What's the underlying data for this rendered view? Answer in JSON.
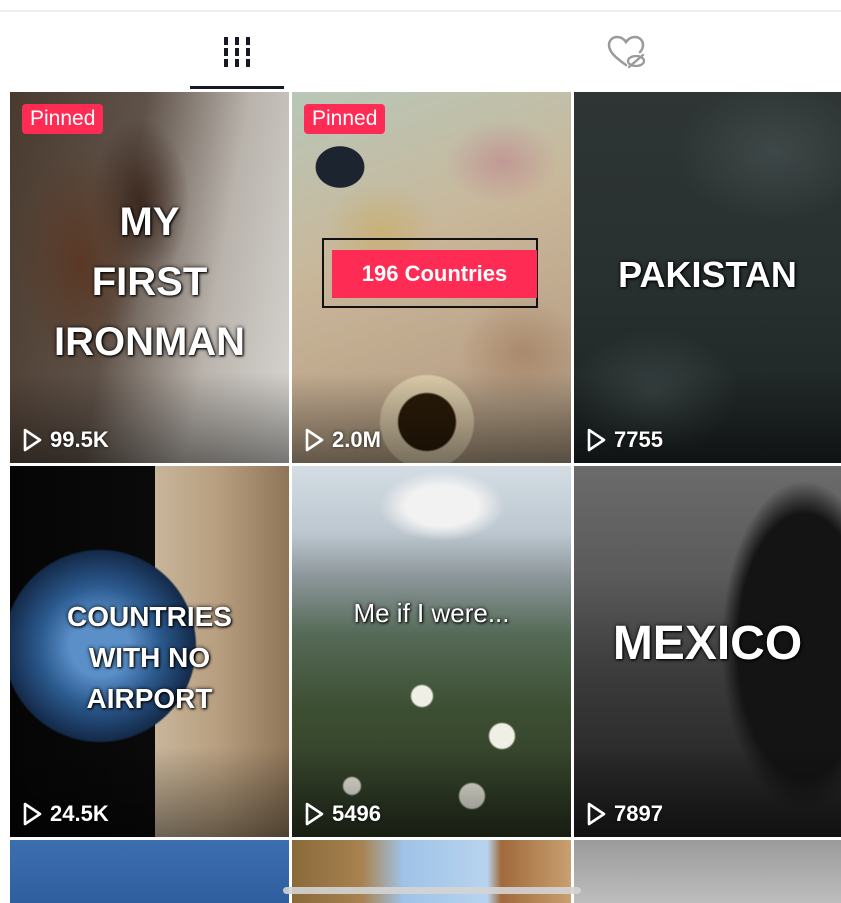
{
  "tabs": [
    {
      "name": "videos",
      "icon": "grid-bars-icon",
      "active": true
    },
    {
      "name": "liked",
      "icon": "liked-hidden-icon",
      "active": false
    }
  ],
  "colors": {
    "accent": "#fe2c55",
    "indicator": "#161823"
  },
  "videos": [
    {
      "pinned_label": "Pinned",
      "caption": "MY\nFIRST\nIRONMAN",
      "views": "99.5K"
    },
    {
      "pinned_label": "Pinned",
      "badge": "196 Countries",
      "views": "2.0M"
    },
    {
      "caption": "PAKISTAN",
      "views": "7755"
    },
    {
      "caption": "COUNTRIES\nWITH NO\nAIRPORT",
      "views": "24.5K"
    },
    {
      "caption": "Me if I were...",
      "views": "5496"
    },
    {
      "caption": "MEXICO",
      "views": "7897"
    }
  ]
}
